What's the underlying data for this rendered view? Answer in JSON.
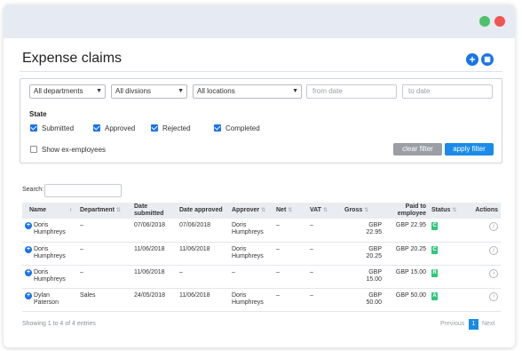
{
  "header": {
    "title": "Expense claims",
    "add_icon": "plus-icon",
    "calendar_icon": "calendar-icon"
  },
  "filters": {
    "departments": "All departments",
    "divisions": "All divsions",
    "locations": "All locations",
    "from_placeholder": "from date",
    "to_placeholder": "to date",
    "state_label": "State",
    "states": [
      {
        "label": "Submitted",
        "checked": true
      },
      {
        "label": "Approved",
        "checked": true
      },
      {
        "label": "Rejected",
        "checked": true
      },
      {
        "label": "Completed",
        "checked": true
      }
    ],
    "ex_employees": {
      "label": "Show ex-employees",
      "checked": false
    },
    "clear_label": "clear filter",
    "apply_label": "apply filter"
  },
  "search": {
    "label": "Search:",
    "value": ""
  },
  "table": {
    "columns": [
      "Name",
      "Department",
      "Date submitted",
      "Date approved",
      "Approver",
      "Net",
      "VAT",
      "Gross",
      "Paid to employee",
      "Status",
      "Actions"
    ],
    "rows": [
      {
        "name": "Doris Humphreys",
        "department": "–",
        "submitted": "07/06/2018",
        "approved": "07/06/2018",
        "approver": "Doris Humphreys",
        "net": "–",
        "vat": "–",
        "gross": "GBP 22.95",
        "paid": "GBP 22.95",
        "status": "C"
      },
      {
        "name": "Doris Humphreys",
        "department": "–",
        "submitted": "11/06/2018",
        "approved": "11/06/2018",
        "approver": "Doris Humphreys",
        "net": "–",
        "vat": "–",
        "gross": "GBP 20.25",
        "paid": "GBP 20.25",
        "status": "C"
      },
      {
        "name": "Doris Humphreys",
        "department": "–",
        "submitted": "11/06/2018",
        "approved": "–",
        "approver": "–",
        "net": "–",
        "vat": "–",
        "gross": "GBP 15.00",
        "paid": "GBP 15.00",
        "status": "R"
      },
      {
        "name": "Dylan Paterson",
        "department": "Sales",
        "submitted": "24/05/2018",
        "approved": "11/06/2018",
        "approver": "Doris Humphreys",
        "net": "–",
        "vat": "–",
        "gross": "GBP 50.00",
        "paid": "GBP 50.00",
        "status": "A"
      }
    ]
  },
  "footer": {
    "info": "Showing 1 to 4 of 4 entries",
    "previous": "Previous",
    "page": "1",
    "next": "Next"
  },
  "colors": {
    "accent": "#1a73e8",
    "status_green": "#2ec87a",
    "close_red": "#ef5455",
    "max_green": "#4cc26a"
  }
}
